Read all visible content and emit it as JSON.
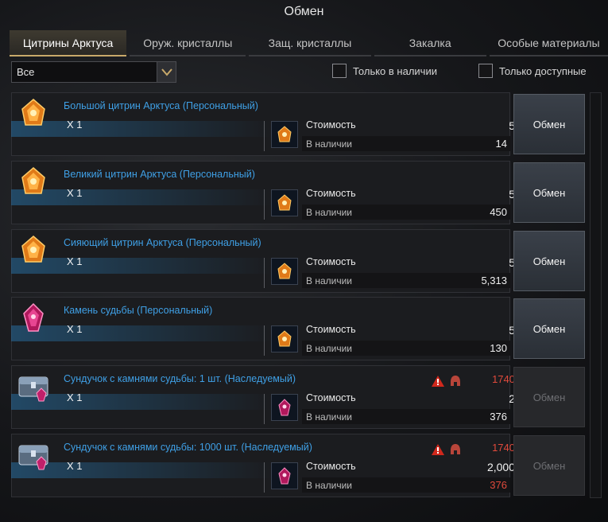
{
  "window": {
    "title": "Обмен"
  },
  "tabs": [
    {
      "label": "Цитрины Арктуса",
      "active": true
    },
    {
      "label": "Оруж. кристаллы",
      "active": false
    },
    {
      "label": "Защ. кристаллы",
      "active": false
    },
    {
      "label": "Закалка",
      "active": false
    },
    {
      "label": "Особые материалы",
      "active": false
    }
  ],
  "filter": {
    "selected": "Все"
  },
  "checkboxes": {
    "in_stock": {
      "label": "Только в наличии",
      "checked": false
    },
    "available": {
      "label": "Только доступные",
      "checked": false
    }
  },
  "colors": {
    "name": "#3fa0e6",
    "warning": "#e04a3c",
    "tab_accent": "#c8a96a"
  },
  "labels": {
    "cost": "Стоимость",
    "in_stock": "В наличии"
  },
  "items": [
    {
      "name": "Большой цитрин Арктуса (Персональный)",
      "qty": "X 1",
      "icon": "citrine-gem-icon",
      "cost": "5",
      "in_stock": "14",
      "in_stock_red": false,
      "button": "Обмен",
      "enabled": true,
      "requirement": ""
    },
    {
      "name": "Великий цитрин Арктуса (Персональный)",
      "qty": "X 1",
      "icon": "citrine-gem-icon",
      "cost": "5",
      "in_stock": "450",
      "in_stock_red": false,
      "button": "Обмен",
      "enabled": true,
      "requirement": ""
    },
    {
      "name": "Сияющий цитрин Арктуса (Персональный)",
      "qty": "X 1",
      "icon": "citrine-gem-icon",
      "cost": "5",
      "in_stock": "5,313",
      "in_stock_red": false,
      "button": "Обмен",
      "enabled": true,
      "requirement": ""
    },
    {
      "name": "Камень судьбы (Персональный)",
      "qty": "X 1",
      "icon": "destiny-stone-icon",
      "cost": "5",
      "in_stock": "130",
      "in_stock_red": false,
      "button": "Обмен",
      "enabled": true,
      "requirement": ""
    },
    {
      "name": "Сундучок с камнями судьбы: 1 шт. (Наследуемый)",
      "qty": "X 1",
      "icon": "chest-icon",
      "cost": "2",
      "in_stock": "376",
      "in_stock_red": false,
      "button": "Обмен",
      "enabled": false,
      "requirement": "1740"
    },
    {
      "name": "Сундучок с камнями судьбы: 1000 шт. (Наследуемый)",
      "qty": "X 1",
      "icon": "chest-icon",
      "cost": "2,000",
      "in_stock": "376",
      "in_stock_red": true,
      "button": "Обмен",
      "enabled": false,
      "requirement": "1740"
    }
  ]
}
